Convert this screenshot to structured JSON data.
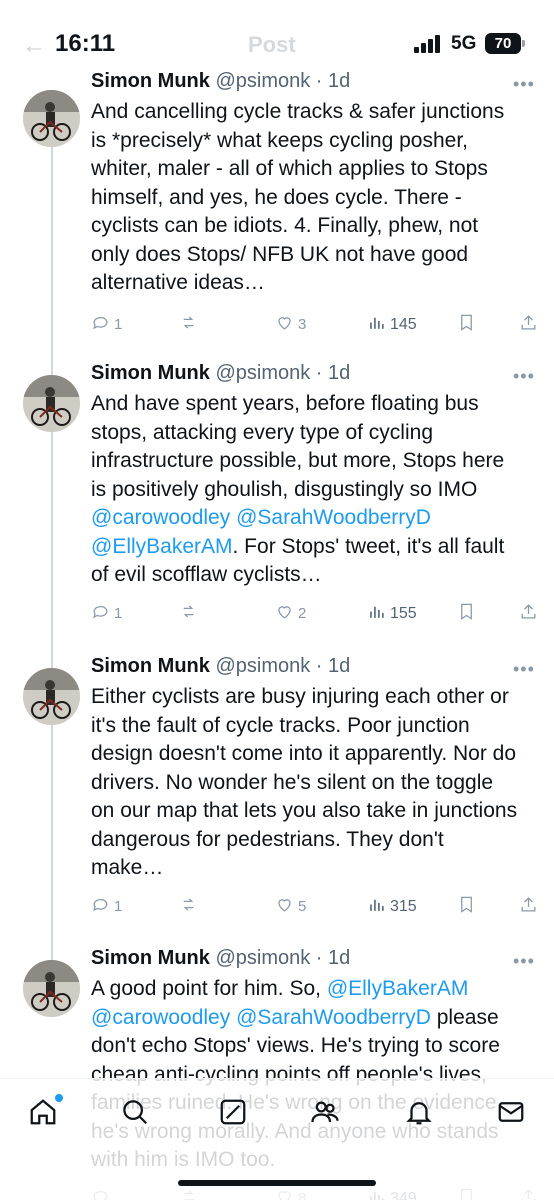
{
  "status_bar": {
    "time": "16:11",
    "network": "5G",
    "battery": "70"
  },
  "header": {
    "back_glyph": "←",
    "title": "Post"
  },
  "tweets": [
    {
      "name": "Simon Munk",
      "handle": "@psimonk",
      "time": "· 1d",
      "text_parts": [
        "And cancelling cycle tracks & safer junctions is *precisely* what keeps cycling posher, whiter, maler - all of which applies to Stops himself, and yes, he does cycle. There - cyclists can be idiots. 4. Finally, phew, not only does Stops/ NFB UK not have good alternative ideas…"
      ],
      "replies": "1",
      "reposts": "",
      "likes": "3",
      "views": "145"
    },
    {
      "name": "Simon Munk",
      "handle": "@psimonk",
      "time": "· 1d",
      "text_parts": [
        "And have spent years, before floating bus stops, attacking every type of cycling infrastructure possible, but more, Stops here is positively ghoulish, disgustingly so IMO ",
        "@carowoodley",
        " ",
        "@SarahWoodberryD",
        " ",
        "@EllyBakerAM",
        ". For Stops' tweet, it's all fault of evil scofflaw cyclists…"
      ],
      "replies": "1",
      "reposts": "",
      "likes": "2",
      "views": "155"
    },
    {
      "name": "Simon Munk",
      "handle": "@psimonk",
      "time": "· 1d",
      "text_parts": [
        "Either cyclists are busy injuring each other or it's the fault of cycle tracks. Poor junction design doesn't come into it apparently. Nor do drivers. No wonder he's silent on the toggle on our map that lets you also take in junctions dangerous for pedestrians. They don't make…"
      ],
      "replies": "1",
      "reposts": "",
      "likes": "5",
      "views": "315"
    },
    {
      "name": "Simon Munk",
      "handle": "@psimonk",
      "time": "· 1d",
      "text_parts": [
        "A good point for him. So, ",
        "@EllyBakerAM",
        " ",
        "@carowoodley",
        " ",
        "@SarahWoodberryD",
        " please don't echo Stops' views. He's trying to score cheap anti-cycling points off people's lives, families ruined. He's wrong on the evidence, he's wrong morally. And anyone who stands with him is IMO too."
      ],
      "replies": "",
      "reposts": "",
      "likes": "8",
      "views": "349"
    }
  ],
  "nav": [
    "home-icon",
    "search-icon",
    "grok-icon",
    "communities-icon",
    "notifications-icon",
    "messages-icon"
  ],
  "colors": {
    "accent": "#1d9bf0",
    "text": "#0f1419",
    "muted": "#536471"
  }
}
